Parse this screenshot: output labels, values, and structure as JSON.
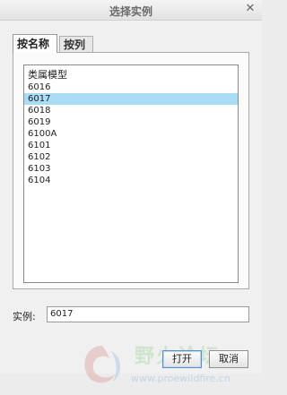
{
  "window": {
    "title": "选择实例"
  },
  "tabs": [
    {
      "label": "按名称",
      "active": true
    },
    {
      "label": "按列",
      "active": false
    }
  ],
  "list": {
    "header": "类属模型",
    "items": [
      "6016",
      "6017",
      "6018",
      "6019",
      "6100A",
      "6101",
      "6102",
      "6103",
      "6104"
    ],
    "selected": "6017"
  },
  "instance": {
    "label": "实例:",
    "value": "6017"
  },
  "buttons": {
    "open": "打开",
    "cancel": "取消"
  },
  "watermark": {
    "text": "野火论坛",
    "url": "www.proewildfire.cn"
  },
  "colors": {
    "selection": "#a9dcf5",
    "accent_border": "#5a8fc8"
  }
}
